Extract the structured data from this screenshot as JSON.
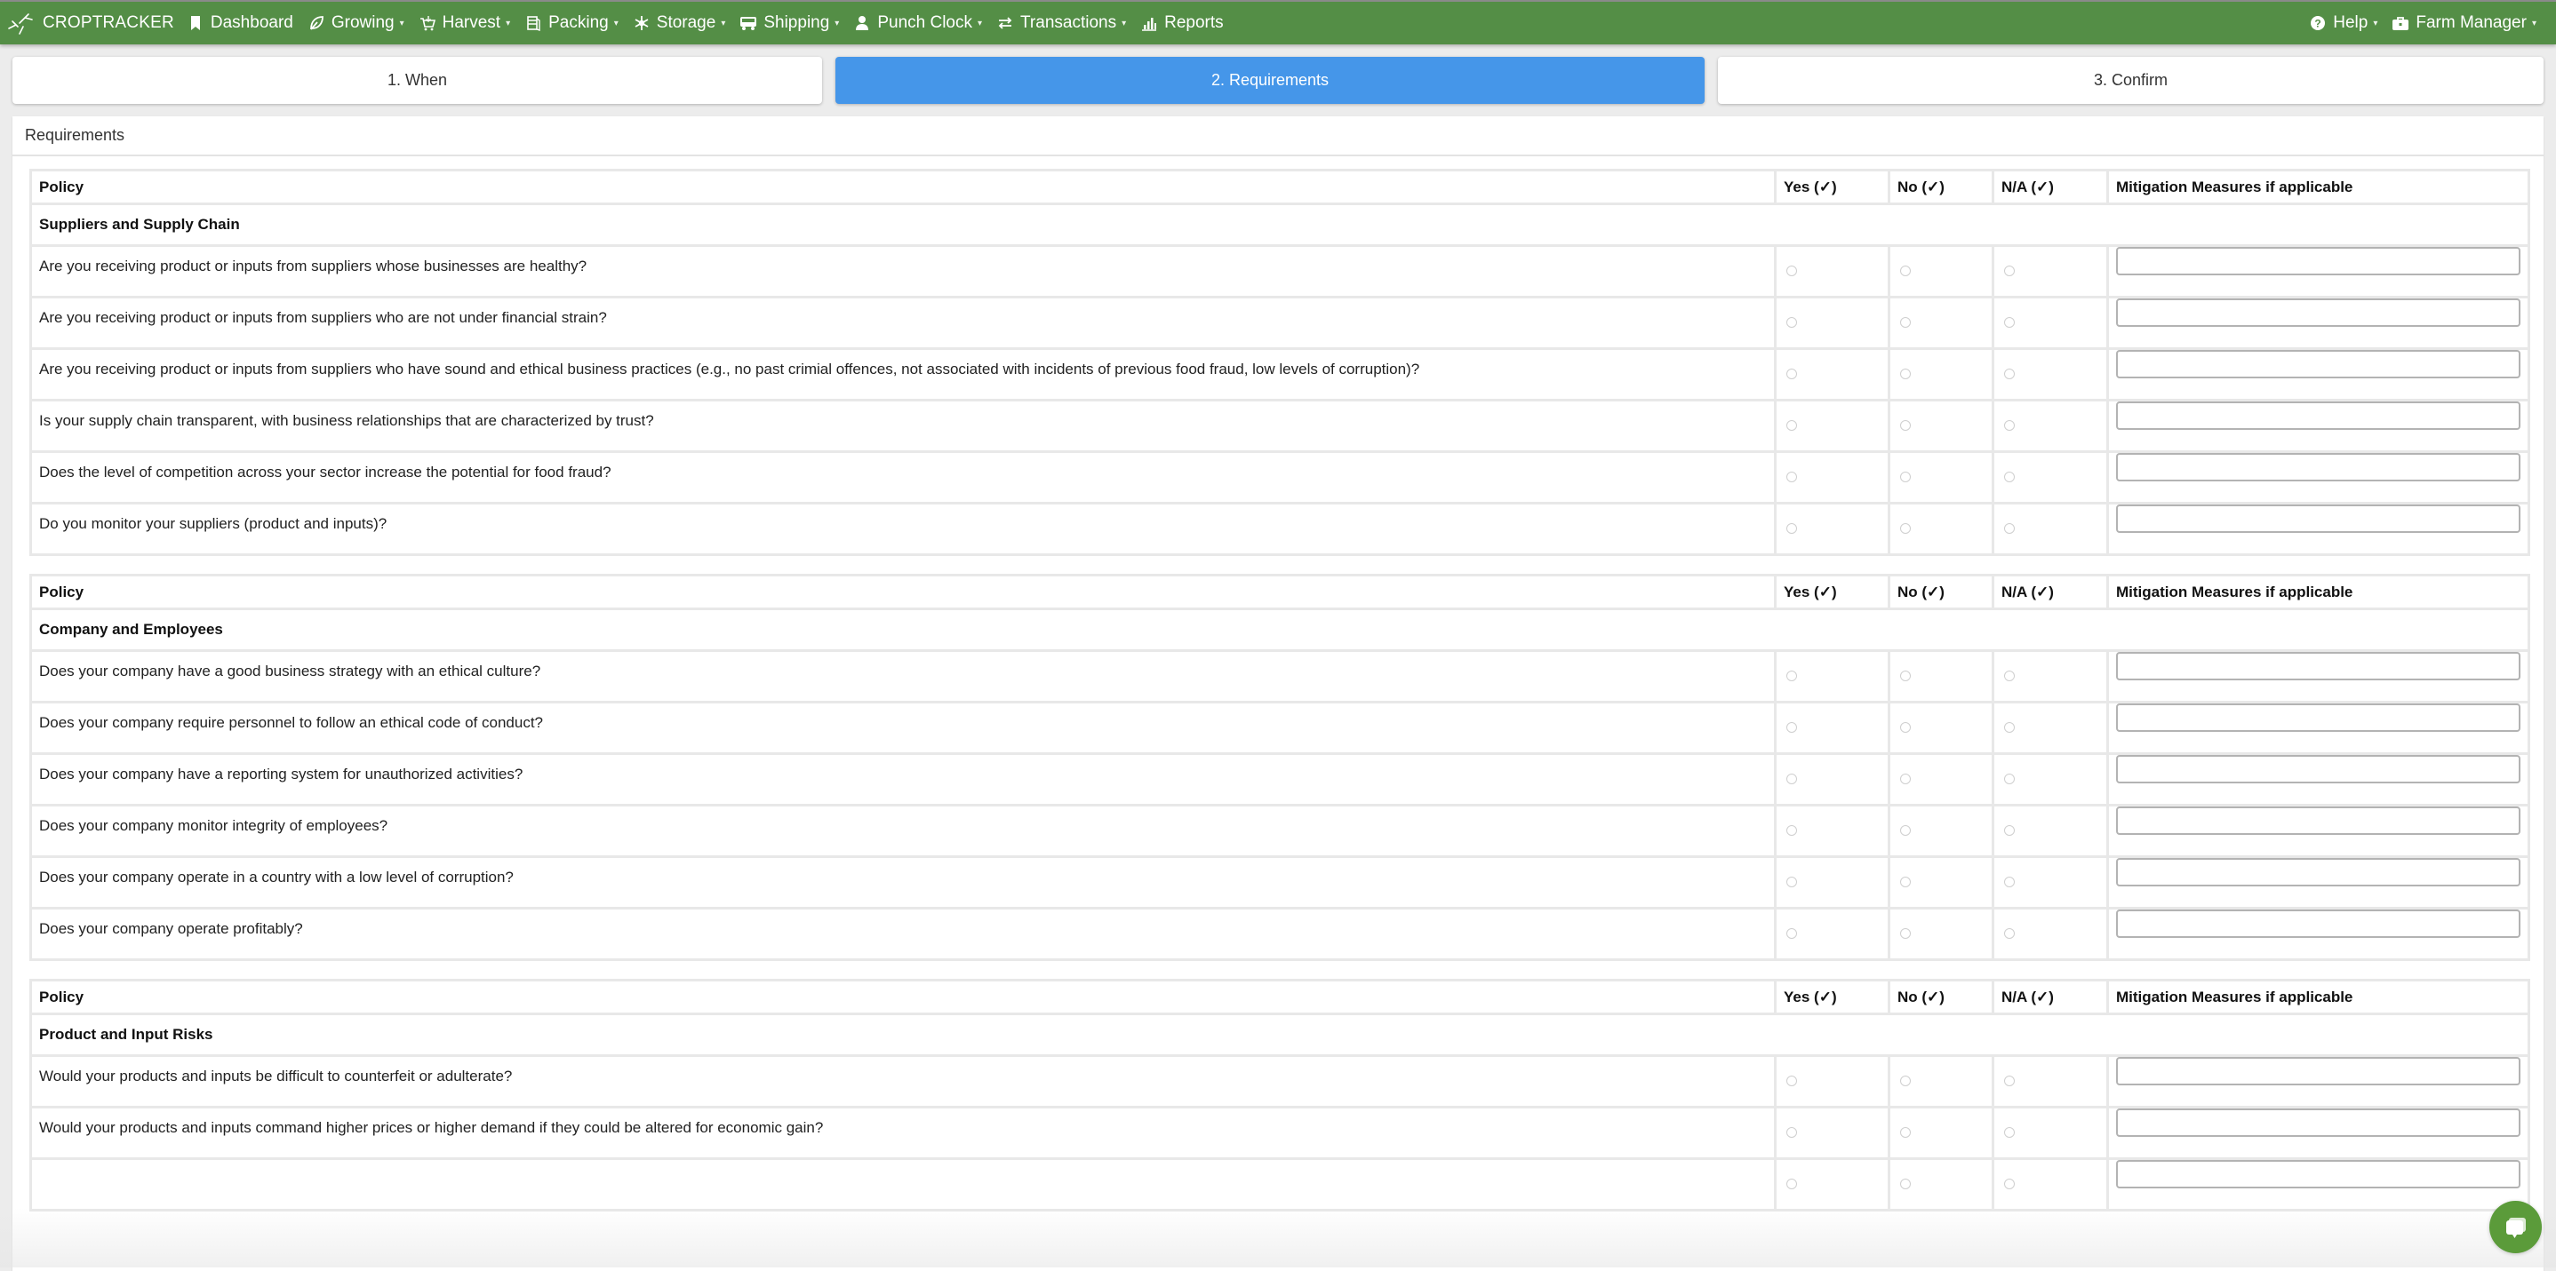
{
  "navbar": {
    "brand": "CROPTRACKER",
    "items": [
      {
        "label": "Dashboard",
        "icon": "bookmark-icon",
        "dropdown": false
      },
      {
        "label": "Growing",
        "icon": "leaf-icon",
        "dropdown": true
      },
      {
        "label": "Harvest",
        "icon": "basket-icon",
        "dropdown": true
      },
      {
        "label": "Packing",
        "icon": "boxes-icon",
        "dropdown": true
      },
      {
        "label": "Storage",
        "icon": "snowflake-icon",
        "dropdown": true
      },
      {
        "label": "Shipping",
        "icon": "truck-icon",
        "dropdown": true
      },
      {
        "label": "Punch Clock",
        "icon": "user-icon",
        "dropdown": true
      },
      {
        "label": "Transactions",
        "icon": "exchange-icon",
        "dropdown": true
      },
      {
        "label": "Reports",
        "icon": "bar-chart-icon",
        "dropdown": false
      }
    ],
    "right": [
      {
        "label": "Help",
        "icon": "question-circle-icon",
        "dropdown": true
      },
      {
        "label": "Farm Manager",
        "icon": "briefcase-icon",
        "dropdown": true
      }
    ]
  },
  "steps": [
    {
      "label": "1. When",
      "active": false
    },
    {
      "label": "2. Requirements",
      "active": true
    },
    {
      "label": "3. Confirm",
      "active": false
    }
  ],
  "panel": {
    "title": "Requirements"
  },
  "table_headers": {
    "policy": "Policy",
    "yes": "Yes (✓)",
    "no": "No (✓)",
    "na": "N/A (✓)",
    "mitigation": "Mitigation Measures if applicable"
  },
  "sections": [
    {
      "title": "Suppliers and Supply Chain",
      "questions": [
        "Are you receiving product or inputs from suppliers whose businesses are healthy?",
        "Are you receiving product or inputs from suppliers who are not under financial strain?",
        "Are you receiving product or inputs from suppliers who have sound and ethical business practices (e.g., no past crimial offences, not associated with incidents of previous food fraud, low levels of corruption)?",
        "Is your supply chain transparent, with business relationships that are characterized by trust?",
        "Does the level of competition across your sector increase the potential for food fraud?",
        "Do you monitor your suppliers (product and inputs)?"
      ]
    },
    {
      "title": "Company and Employees",
      "questions": [
        "Does your company have a good business strategy with an ethical culture?",
        "Does your company require personnel to follow an ethical code of conduct?",
        "Does your company have a reporting system for unauthorized activities?",
        "Does your company monitor integrity of employees?",
        "Does your company operate in a country with a low level of corruption?",
        "Does your company operate profitably?"
      ]
    },
    {
      "title": "Product and Input Risks",
      "questions": [
        "Would your products and inputs be difficult to counterfeit or adulterate?",
        "Would your products and inputs command higher prices or higher demand if they could be altered for economic gain?",
        ""
      ]
    }
  ],
  "chat": {
    "icon": "chat-bubble-icon"
  },
  "colors": {
    "navbar": "#548e46",
    "active_step": "#4596e9",
    "chat": "#5b9b3a"
  }
}
